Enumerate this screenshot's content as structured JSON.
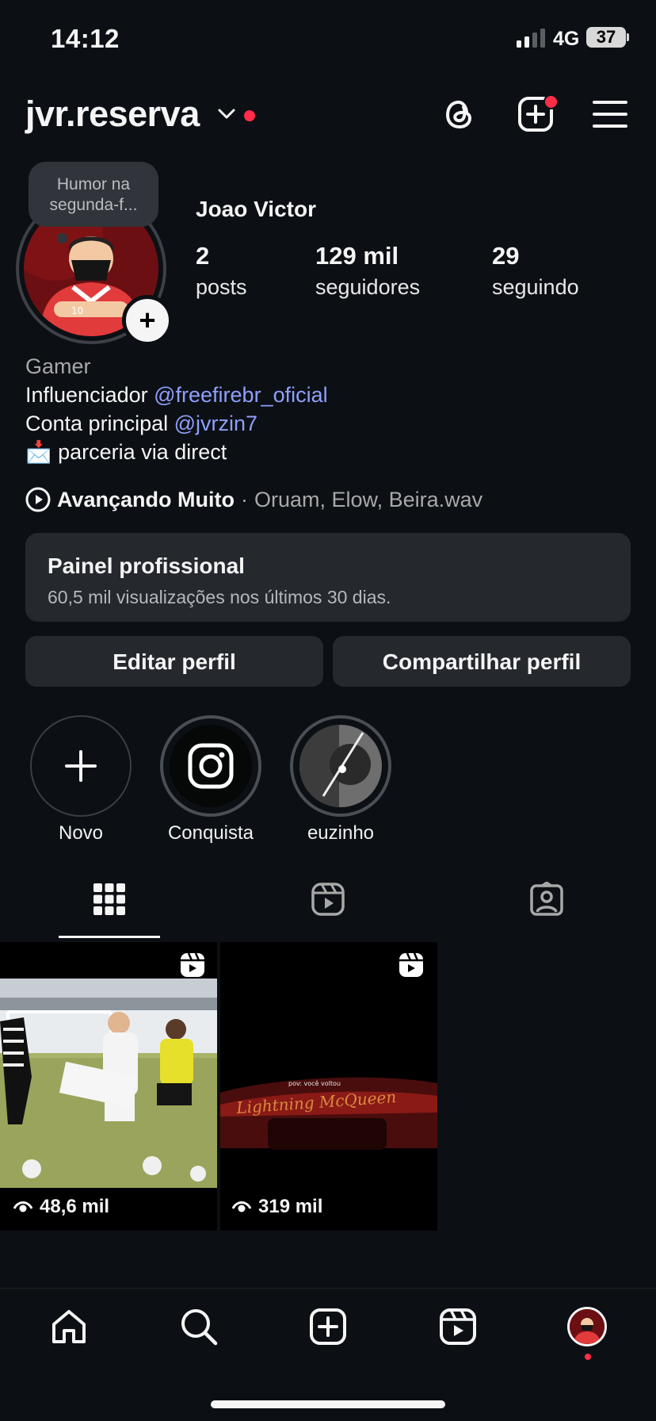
{
  "status_bar": {
    "time": "14:12",
    "network": "4G",
    "battery": "37"
  },
  "header": {
    "username": "jvr.reserva"
  },
  "profile": {
    "note": "Humor na segunda-f...",
    "name": "Joao Victor",
    "stats": [
      {
        "value": "2",
        "label": "posts"
      },
      {
        "value": "129 mil",
        "label": "seguidores"
      },
      {
        "value": "29",
        "label": "seguindo"
      }
    ],
    "bio": {
      "category": "Gamer",
      "line1_text": "Influenciador ",
      "line1_link": "@freefirebr_oficial",
      "line2_text": "Conta principal ",
      "line2_link": "@jvrzin7",
      "line3_emoji": "📩",
      "line3_text": "parceria via direct"
    },
    "music": {
      "title": "Avançando Muito",
      "separator": "·",
      "artists": "Oruam, Elow, Beira.wav"
    }
  },
  "dashboard": {
    "title": "Painel profissional",
    "subtitle": "60,5 mil visualizações nos últimos 30 dias."
  },
  "buttons": {
    "edit": "Editar perfil",
    "share": "Compartilhar perfil"
  },
  "highlights": [
    {
      "label": "Novo"
    },
    {
      "label": "Conquista"
    },
    {
      "label": "euzinho"
    }
  ],
  "posts": [
    {
      "views": "48,6 mil",
      "caption": ""
    },
    {
      "views": "319 mil",
      "caption": "pov: você voltou"
    }
  ],
  "colors": {
    "accent_link": "#8f9ffc",
    "notification": "#ff2d48",
    "background": "#0c1014",
    "surface": "#25292e"
  }
}
